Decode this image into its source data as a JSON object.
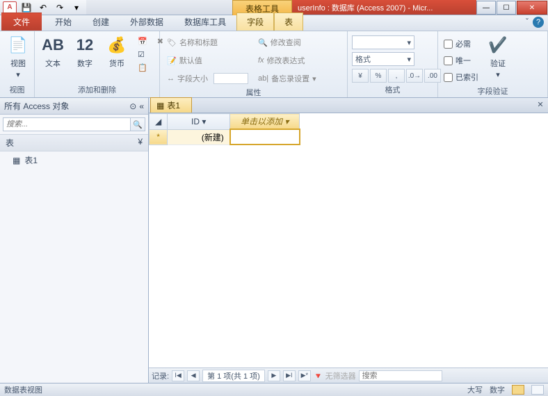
{
  "titlebar": {
    "tool_tab": "表格工具",
    "title": "userInfo : 数据库 (Access 2007)  -  Micr..."
  },
  "ribbon_tabs": {
    "file": "文件",
    "items": [
      "开始",
      "创建",
      "外部数据",
      "数据库工具"
    ],
    "ctx": [
      "字段",
      "表"
    ],
    "active": "字段"
  },
  "ribbon": {
    "g_view": {
      "label": "视图",
      "btn": "视图"
    },
    "g_add_del": {
      "label": "添加和删除",
      "text": "文本",
      "number": "数字",
      "currency": "货币"
    },
    "g_props": {
      "label": "属性",
      "name_title": "名称和标题",
      "default": "默认值",
      "field_size": "字段大小",
      "mod_query": "修改查阅",
      "mod_expr": "修改表达式",
      "memo_set": "备忘录设置"
    },
    "g_format": {
      "label": "格式",
      "format_combo": "格式"
    },
    "g_validation": {
      "label": "字段验证",
      "required": "必需",
      "unique": "唯一",
      "indexed": "已索引",
      "validate": "验证"
    }
  },
  "nav": {
    "header": "所有 Access 对象",
    "search_placeholder": "搜索...",
    "group": "表",
    "items": [
      "表1"
    ]
  },
  "doc": {
    "tab": "表1",
    "columns": {
      "id": "ID",
      "add": "单击以添加"
    },
    "newrow_id": "(新建)"
  },
  "recnav": {
    "label": "记录:",
    "info": "第 1 项(共 1 项)",
    "filter": "无筛选器",
    "search": "搜索"
  },
  "status": {
    "view": "数据表视图",
    "caps": "大写",
    "num": "数字"
  }
}
